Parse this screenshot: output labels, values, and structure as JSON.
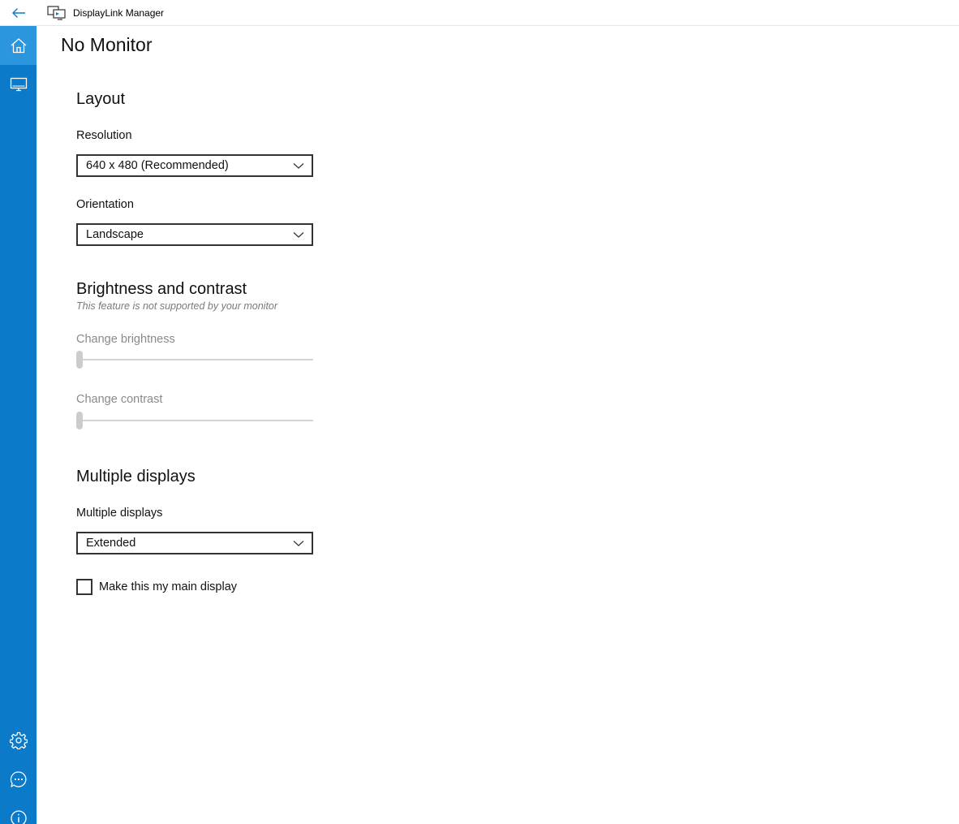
{
  "window": {
    "app_title": "DisplayLink Manager"
  },
  "colors": {
    "sidebar": "#0a7ac9",
    "sidebar_active": "#2b95dd",
    "back_arrow": "#0a7ac9"
  },
  "page": {
    "title": "No Monitor"
  },
  "layout": {
    "heading": "Layout",
    "resolution": {
      "label": "Resolution",
      "value": "640 x 480 (Recommended)"
    },
    "orientation": {
      "label": "Orientation",
      "value": "Landscape"
    }
  },
  "brightness_contrast": {
    "heading": "Brightness and contrast",
    "note": "This feature is not supported by your monitor",
    "brightness": {
      "label": "Change brightness",
      "value_fraction": 0
    },
    "contrast": {
      "label": "Change contrast",
      "value_fraction": 0
    }
  },
  "multiple_displays": {
    "heading": "Multiple displays",
    "select": {
      "label": "Multiple displays",
      "value": "Extended"
    },
    "main_display_checkbox": {
      "label": "Make this my main display",
      "checked": false
    }
  },
  "icons": {
    "back": "back-arrow-icon",
    "app": "displaylink-app-icon",
    "home": "home-icon",
    "monitor": "monitor-icon",
    "settings": "gear-icon",
    "feedback": "chat-bubble-icon",
    "info": "info-icon"
  }
}
